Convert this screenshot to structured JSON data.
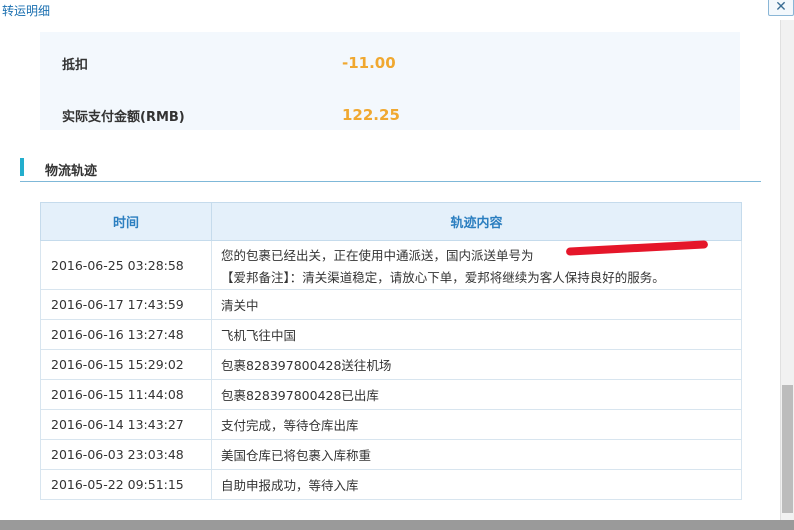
{
  "window": {
    "title": "转运明细",
    "close_glyph": "✕"
  },
  "summary": {
    "rows": [
      {
        "label": "抵扣",
        "value": "-11.00"
      },
      {
        "label": "实际支付金额(RMB)",
        "value": "122.25"
      }
    ]
  },
  "logistics": {
    "section_title": "物流轨迹",
    "columns": [
      "时间",
      "轨迹内容"
    ],
    "rows": [
      {
        "time": "2016-06-25 03:28:58",
        "line1": "您的包裹已经出关，正在使用中通派送，国内派送单号为",
        "line2": "【爱邦备注】：清关渠道稳定，请放心下单，爱邦将继续为客人保持良好的服务。"
      },
      {
        "time": "2016-06-17 17:43:59",
        "line1": "清关中"
      },
      {
        "time": "2016-06-16 13:27:48",
        "line1": "飞机飞往中国"
      },
      {
        "time": "2016-06-15 15:29:02",
        "line1": "包裹828397800428送往机场"
      },
      {
        "time": "2016-06-15 11:44:08",
        "line1": "包裹828397800428已出库"
      },
      {
        "time": "2016-06-14 13:43:27",
        "line1": "支付完成，等待仓库出库"
      },
      {
        "time": "2016-06-03 23:03:48",
        "line1": "美国仓库已将包裹入库称重"
      },
      {
        "time": "2016-05-22 09:51:15",
        "line1": "自助申报成功，等待入库"
      }
    ]
  },
  "colors": {
    "accent": "#2c7fc0",
    "amount": "#f0a830",
    "section_mark": "#23aecd",
    "redaction": "#e5162a"
  }
}
